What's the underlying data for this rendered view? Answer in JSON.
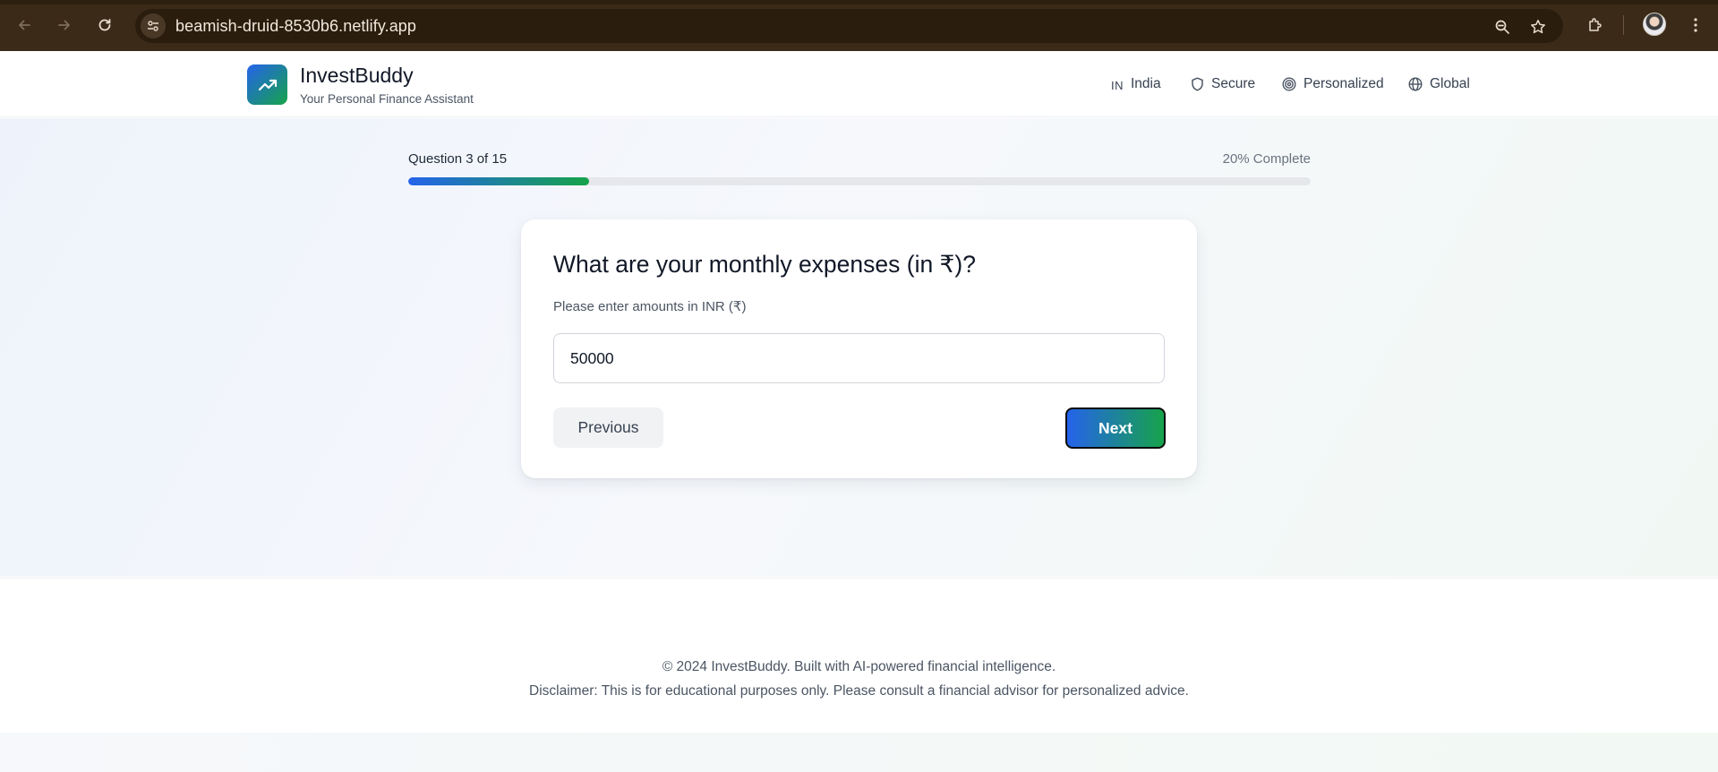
{
  "browser": {
    "url": "beamish-druid-8530b6.netlify.app"
  },
  "header": {
    "brand_name": "InvestBuddy",
    "brand_tagline": "Your Personal Finance Assistant",
    "nav": [
      {
        "icon": "flag-icon",
        "prefix": "IN",
        "label": "India"
      },
      {
        "icon": "shield-icon",
        "label": "Secure"
      },
      {
        "icon": "target-icon",
        "label": "Personalized"
      },
      {
        "icon": "globe-icon",
        "label": "Global"
      }
    ]
  },
  "progress": {
    "label": "Question 3 of 15",
    "percent_label": "20% Complete",
    "fill_fraction": 0.2
  },
  "question_card": {
    "question": "What are your monthly expenses (in ₹)?",
    "hint": "Please enter amounts in INR (₹)",
    "input_value": "50000",
    "previous_label": "Previous",
    "next_label": "Next"
  },
  "footer": {
    "line1": "© 2024 InvestBuddy. Built with AI-powered financial intelligence.",
    "line2": "Disclaimer: This is for educational purposes only. Please consult a financial advisor for personalized advice."
  },
  "colors": {
    "accent_blue": "#2563eb",
    "accent_green": "#16a34a",
    "chrome_bg": "#3b2a17"
  }
}
